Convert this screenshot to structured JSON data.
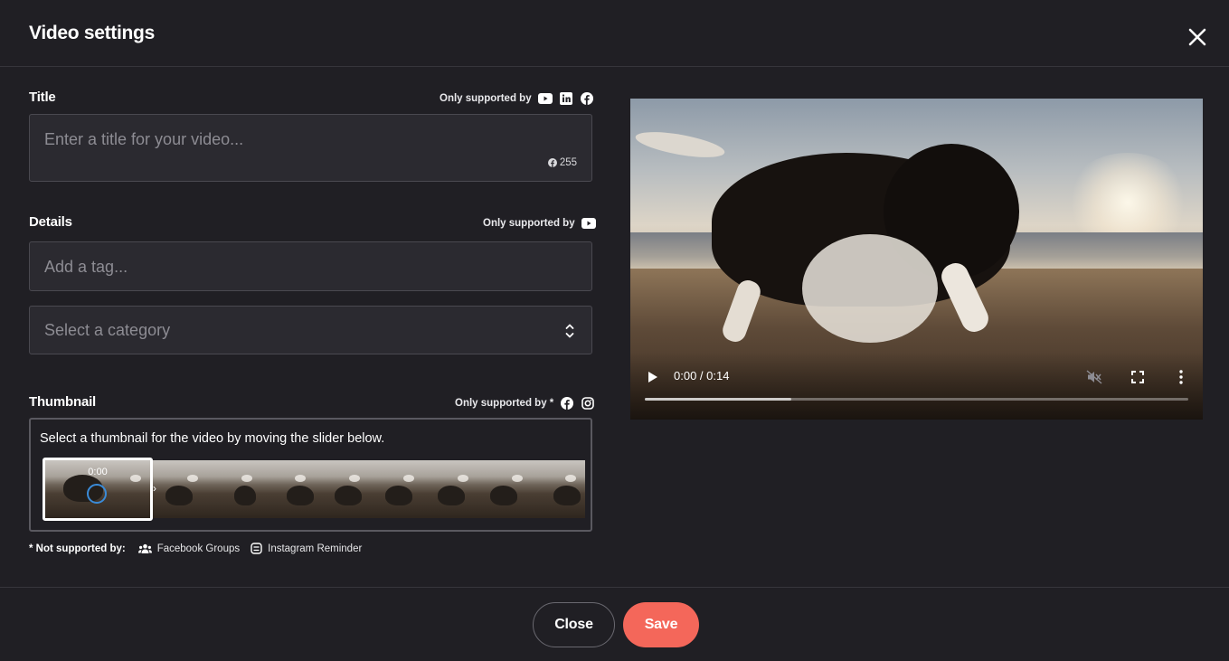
{
  "dialog": {
    "title": "Video settings"
  },
  "title_section": {
    "label": "Title",
    "support_text": "Only supported by",
    "support_icons": [
      "youtube-icon",
      "linkedin-icon",
      "facebook-icon"
    ],
    "placeholder": "Enter a title for your video...",
    "char_counter": "255"
  },
  "details_section": {
    "label": "Details",
    "support_text": "Only supported by",
    "support_icons": [
      "youtube-icon"
    ],
    "tag_placeholder": "Add a tag...",
    "category_placeholder": "Select a category"
  },
  "thumbnail_section": {
    "label": "Thumbnail",
    "support_text": "Only supported by *",
    "support_icons": [
      "facebook-icon",
      "instagram-icon"
    ],
    "hint": "Select a thumbnail for the video by moving the slider below.",
    "selected_time": "0:00",
    "frame_count": 9
  },
  "not_supported": {
    "label": "* Not supported by:",
    "items": [
      {
        "icon": "users-icon",
        "label": "Facebook Groups"
      },
      {
        "icon": "instagram-reminder-icon",
        "label": "Instagram Reminder"
      }
    ]
  },
  "video": {
    "time": "0:00 / 0:14",
    "buffered_fraction": 0.27
  },
  "footer": {
    "close_label": "Close",
    "save_label": "Save"
  },
  "colors": {
    "background": "#201f24",
    "field_bg": "#2b2a30",
    "accent": "#f4675a",
    "progress_ring": "#3a8bd8"
  }
}
